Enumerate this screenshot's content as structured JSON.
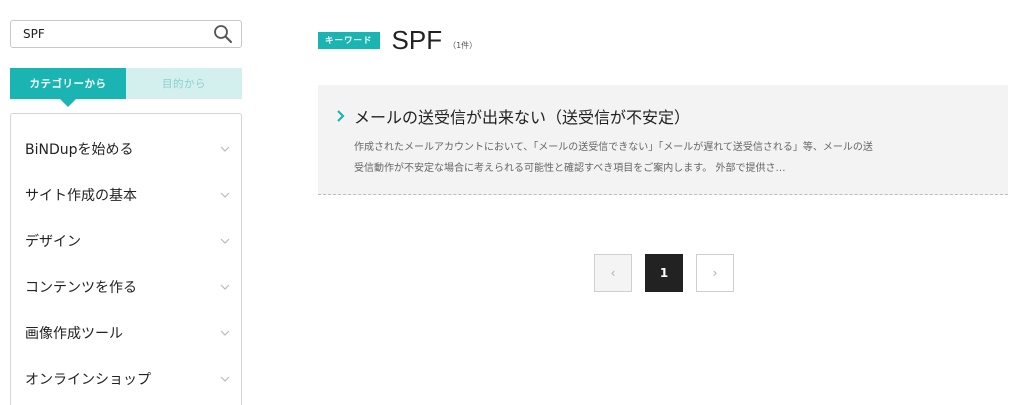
{
  "search": {
    "value": "SPF",
    "icon": "search-icon"
  },
  "tabs": {
    "category": "カテゴリーから",
    "purpose": "目的から"
  },
  "categories": [
    {
      "label": "BiNDupを始める"
    },
    {
      "label": "サイト作成の基本"
    },
    {
      "label": "デザイン"
    },
    {
      "label": "コンテンツを作る"
    },
    {
      "label": "画像作成ツール"
    },
    {
      "label": "オンラインショップ"
    }
  ],
  "keyword": {
    "badge": "キーワード",
    "term": "SPF",
    "count": "（1件）"
  },
  "results": [
    {
      "title": "メールの送受信が出来ない（送受信が不安定）",
      "description_line1": "作成されたメールアカウントにおいて、「メールの送受信できない」「メールが遅れて送受信される」等、メールの送",
      "description_line2": "受信動作が不安定な場合に考えられる可能性と確認すべき項目をご案内します。 外部で提供さ…"
    }
  ],
  "pagination": {
    "prev": "‹",
    "current": "1",
    "next": "›"
  },
  "colors": {
    "accent": "#1ab5b2",
    "accent_light": "#d3f0ef",
    "result_bg": "#f3f3f3",
    "pager_active": "#222222"
  }
}
